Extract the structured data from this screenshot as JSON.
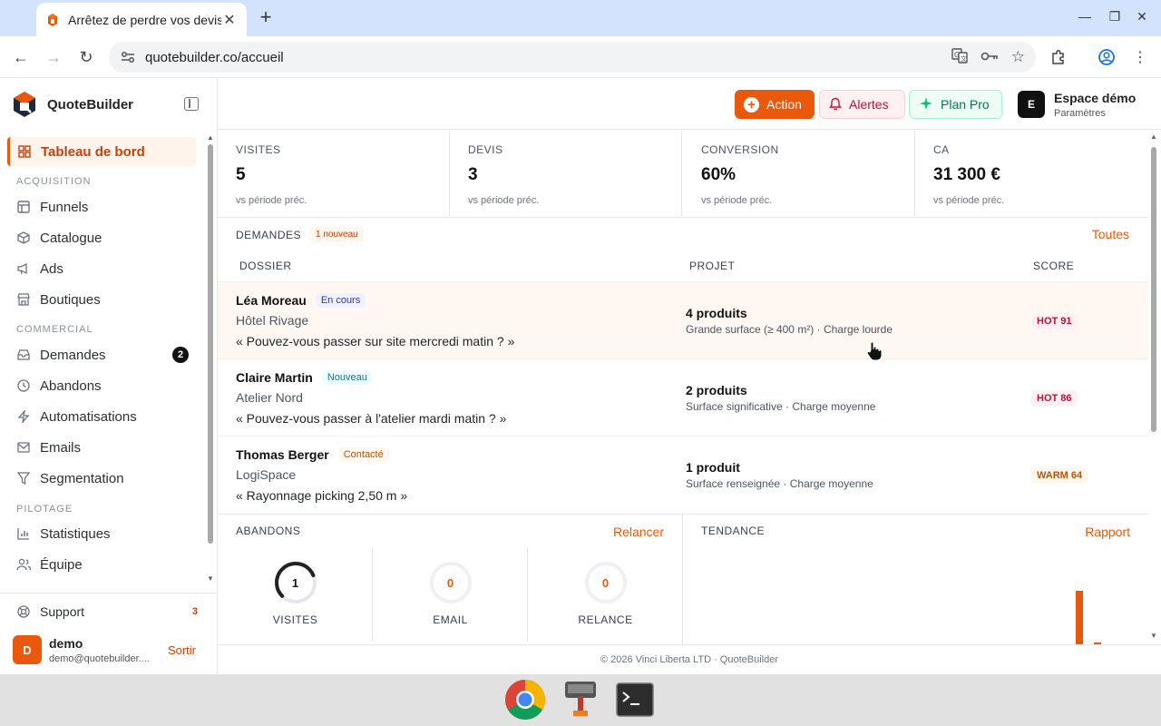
{
  "browser": {
    "tab_title": "Arrêtez de perdre vos devis",
    "url": "quotebuilder.co/accueil"
  },
  "sidebar": {
    "brand": "QuoteBuilder",
    "active_item": "Tableau de bord",
    "sections": {
      "acquisition": "ACQUISITION",
      "commercial": "COMMERCIAL",
      "pilotage": "PILOTAGE"
    },
    "items": {
      "funnels": "Funnels",
      "catalogue": "Catalogue",
      "ads": "Ads",
      "boutiques": "Boutiques",
      "demandes": "Demandes",
      "demandes_badge": "2",
      "abandons": "Abandons",
      "automatisations": "Automatisations",
      "emails": "Emails",
      "segmentation": "Segmentation",
      "statistiques": "Statistiques",
      "equipe": "Équipe"
    },
    "support": "Support",
    "support_badge": "3",
    "user": {
      "initial": "D",
      "name": "demo",
      "email": "demo@quotebuilder....",
      "signout": "Sortir"
    }
  },
  "topbar": {
    "action": "Action",
    "alerts": "Alertes",
    "plan": "Plan Pro",
    "workspace_initial": "E",
    "workspace_name": "Espace démo",
    "workspace_sub": "Paramètres"
  },
  "kpis": [
    {
      "label": "VISITES",
      "value": "5",
      "sub": "vs période préc."
    },
    {
      "label": "DEVIS",
      "value": "3",
      "sub": "vs période préc."
    },
    {
      "label": "CONVERSION",
      "value": "60%",
      "sub": "vs période préc."
    },
    {
      "label": "CA",
      "value": "31 300 €",
      "sub": "vs période préc."
    }
  ],
  "demandes": {
    "title": "DEMANDES",
    "new_badge": "1 nouveau",
    "see_all": "Toutes",
    "columns": {
      "dossier": "DOSSIER",
      "projet": "PROJET",
      "score": "SCORE"
    },
    "rows": [
      {
        "name": "Léa Moreau",
        "status": "En cours",
        "company": "Hôtel Rivage",
        "quote": "« Pouvez-vous passer sur site mercredi matin ? »",
        "project": "4 produits",
        "project_sub": "Grande surface (≥ 400 m²) · Charge lourde",
        "score": "HOT 91"
      },
      {
        "name": "Claire Martin",
        "status": "Nouveau",
        "company": "Atelier Nord",
        "quote": "« Pouvez-vous passer à l'atelier mardi matin ? »",
        "project": "2 produits",
        "project_sub": "Surface significative · Charge moyenne",
        "score": "HOT 86"
      },
      {
        "name": "Thomas Berger",
        "status": "Contacté",
        "company": "LogiSpace",
        "quote": "« Rayonnage picking 2,50 m »",
        "project": "1 produit",
        "project_sub": "Surface renseignée · Charge moyenne",
        "score": "WARM 64"
      }
    ]
  },
  "abandons": {
    "title": "ABANDONS",
    "link": "Relancer",
    "gauges": [
      {
        "value": "1",
        "label": "VISITES",
        "ratio": 0.75
      },
      {
        "value": "0",
        "label": "EMAIL",
        "ratio": 0
      },
      {
        "value": "0",
        "label": "RELANCE",
        "ratio": 0
      }
    ]
  },
  "tendance": {
    "title": "TENDANCE",
    "link": "Rapport"
  },
  "footer": "© 2026 Vinci Liberta LTD · QuoteBuilder",
  "colors": {
    "accent": "#ea580c",
    "hot": "#be123c",
    "warm": "#b45309"
  }
}
